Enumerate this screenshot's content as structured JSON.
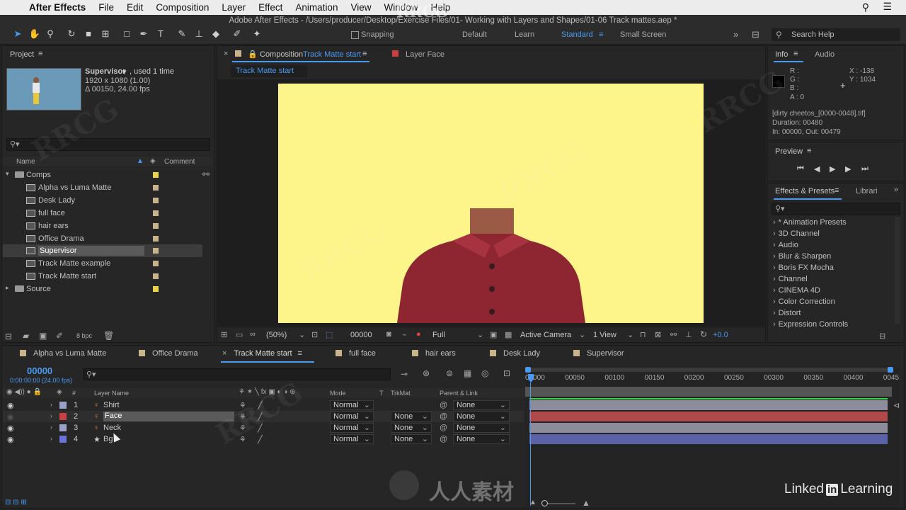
{
  "menubar": {
    "app": "After Effects",
    "items": [
      "File",
      "Edit",
      "Composition",
      "Layer",
      "Effect",
      "Animation",
      "View",
      "Window",
      "Help"
    ]
  },
  "doc_title": "Adobe After Effects - /Users/producer/Desktop/Exercise Files/01- Working with Layers and Shapes/01-06 Track mattes.aep *",
  "toolbar": {
    "snapping": "Snapping",
    "workspaces": [
      "Default",
      "Learn",
      "Standard",
      "Small Screen"
    ],
    "active_workspace": "Standard",
    "search_help": "Search Help"
  },
  "project": {
    "tab": "Project",
    "item_name": "Supervisor",
    "used": ", used 1 time",
    "resolution": "1920 x 1080 (1.00)",
    "duration": "Δ 00150, 24.00 fps",
    "col_name": "Name",
    "col_comment": "Comment",
    "bpc": "8 bpc",
    "tree": [
      {
        "name": "Comps",
        "type": "folder",
        "color": "#e8d44d"
      },
      {
        "name": "Alpha vs Luma Matte",
        "type": "comp",
        "color": "#c9b38a"
      },
      {
        "name": "Desk Lady",
        "type": "comp",
        "color": "#c9b38a"
      },
      {
        "name": "full face",
        "type": "comp",
        "color": "#c9b38a"
      },
      {
        "name": "hair ears",
        "type": "comp",
        "color": "#c9b38a"
      },
      {
        "name": "Office Drama",
        "type": "comp",
        "color": "#c9b38a"
      },
      {
        "name": "Supervisor",
        "type": "comp",
        "color": "#c9b38a",
        "selected": true
      },
      {
        "name": "Track Matte example",
        "type": "comp",
        "color": "#c9b38a"
      },
      {
        "name": "Track Matte start",
        "type": "comp",
        "color": "#c9b38a"
      },
      {
        "name": "Source",
        "type": "folder",
        "color": "#e8d44d"
      }
    ]
  },
  "composition": {
    "tab_prefix": "Composition",
    "tab_name": "Track Matte start",
    "layer_tab": "Layer Face",
    "breadcrumb": "Track Matte start",
    "zoom": "(50%)",
    "timecode": "00000",
    "resolution": "Full",
    "camera": "Active Camera",
    "view": "1 View",
    "exposure": "+0.0"
  },
  "info": {
    "tabs": [
      "Info",
      "Audio"
    ],
    "channels": [
      "R :",
      "G :",
      "B :",
      "A :  0"
    ],
    "x": "X : -138",
    "y": "Y : 1034",
    "file": "[dirty cheetos_[0000-0048].tif]",
    "duration": "Duration: 00480",
    "inout": "In: 00000, Out: 00479"
  },
  "preview": {
    "tab": "Preview"
  },
  "effects": {
    "tab": "Effects & Presets",
    "tab2": "Librari",
    "items": [
      "* Animation Presets",
      "3D Channel",
      "Audio",
      "Blur & Sharpen",
      "Boris FX Mocha",
      "Channel",
      "CINEMA 4D",
      "Color Correction",
      "Distort",
      "Expression Controls"
    ]
  },
  "timeline": {
    "tabs": [
      {
        "name": "Alpha vs Luma Matte",
        "color": "#c9b38a"
      },
      {
        "name": "Office Drama",
        "color": "#c9b38a"
      },
      {
        "name": "Track Matte start",
        "color": "#c9b38a",
        "active": true
      },
      {
        "name": "full face",
        "color": "#c9b38a"
      },
      {
        "name": "hair ears",
        "color": "#c9b38a"
      },
      {
        "name": "Desk Lady",
        "color": "#c9b38a"
      },
      {
        "name": "Supervisor",
        "color": "#c9b38a"
      }
    ],
    "timecode": "00000",
    "timecode_sub": "0:00:00:00 (24.00 fps)",
    "cols": {
      "num": "#",
      "layer_name": "Layer Name",
      "mode": "Mode",
      "t": "T",
      "trkmat": "TrkMat",
      "parent": "Parent & Link"
    },
    "ruler": [
      "00000",
      "00050",
      "00100",
      "00150",
      "00200",
      "00250",
      "00300",
      "00350",
      "00400",
      "0045"
    ],
    "layers": [
      {
        "num": "1",
        "name": "Shirt",
        "mode": "Normal",
        "trkmat": "",
        "parent": "None",
        "color": "#9aa0c8",
        "bar": "#8c8c9c"
      },
      {
        "num": "2",
        "name": "Face",
        "mode": "Normal",
        "trkmat": "None",
        "parent": "None",
        "color": "#c84040",
        "bar": "#b04a4a",
        "selected": true
      },
      {
        "num": "3",
        "name": "Neck",
        "mode": "Normal",
        "trkmat": "None",
        "parent": "None",
        "color": "#9aa0c8",
        "bar": "#8c8c9c"
      },
      {
        "num": "4",
        "name": "Bg",
        "mode": "Normal",
        "trkmat": "None",
        "parent": "None",
        "color": "#6a74d8",
        "bar": "#5a62a8"
      }
    ]
  },
  "branding": {
    "linkedin": "Linked",
    "in": "in",
    "learning": "Learning",
    "watermark": "RRCG",
    "watermark_cn": "人人素材"
  }
}
